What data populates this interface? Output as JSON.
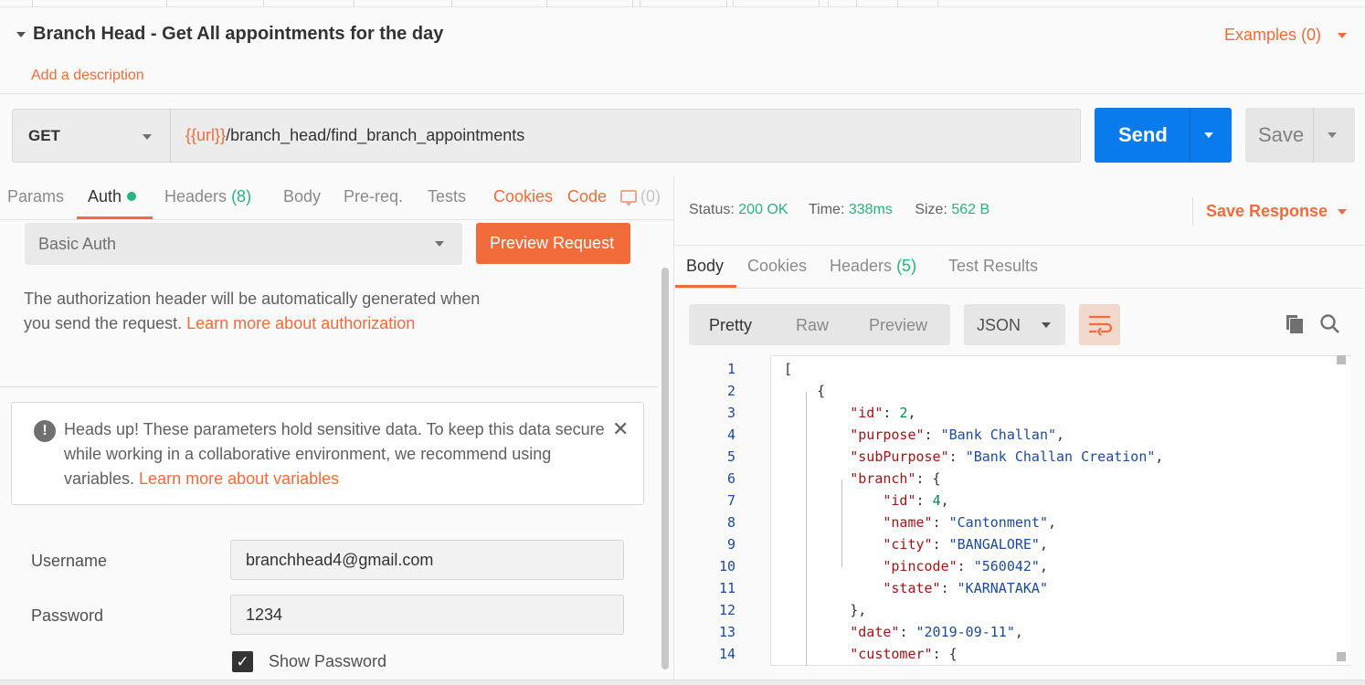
{
  "request": {
    "title": "Branch Head - Get All appointments for the day",
    "examples_label": "Examples (0)",
    "add_description": "Add a description",
    "method": "GET",
    "url_variable": "{{url}}",
    "url_path": "/branch_head/find_branch_appointments",
    "send_label": "Send",
    "save_label": "Save"
  },
  "request_tabs": {
    "params": "Params",
    "auth": "Auth",
    "headers": "Headers",
    "headers_count": "(8)",
    "body": "Body",
    "prereq": "Pre-req.",
    "tests": "Tests",
    "cookies": "Cookies",
    "code": "Code",
    "comments_count": "(0)"
  },
  "auth": {
    "type": "Basic Auth",
    "preview_label": "Preview Request",
    "description_text": "The authorization header will be automatically generated when you send the request. ",
    "description_link": "Learn more about authorization",
    "warning_text": "Heads up! These parameters hold sensitive data. To keep this data secure while working in a collaborative environment, we recommend using variables. ",
    "warning_link": "Learn more about variables",
    "username_label": "Username",
    "username_value": "branchhead4@gmail.com",
    "password_label": "Password",
    "password_value": "1234",
    "show_password_label": "Show Password"
  },
  "response": {
    "status_label": "Status:",
    "status_value": "200 OK",
    "time_label": "Time:",
    "time_value": "338ms",
    "size_label": "Size:",
    "size_value": "562 B",
    "save_response": "Save Response",
    "tabs": {
      "body": "Body",
      "cookies": "Cookies",
      "headers": "Headers",
      "headers_count": "(5)",
      "test_results": "Test Results"
    },
    "views": {
      "pretty": "Pretty",
      "raw": "Raw",
      "preview": "Preview"
    },
    "language": "JSON"
  },
  "code_lines": [
    {
      "n": "1",
      "t": "["
    },
    {
      "n": "2",
      "t": "    {"
    },
    {
      "n": "3",
      "t": "        \"id\": 2,"
    },
    {
      "n": "4",
      "t": "        \"purpose\": \"Bank Challan\","
    },
    {
      "n": "5",
      "t": "        \"subPurpose\": \"Bank Challan Creation\","
    },
    {
      "n": "6",
      "t": "        \"branch\": {"
    },
    {
      "n": "7",
      "t": "            \"id\": 4,"
    },
    {
      "n": "8",
      "t": "            \"name\": \"Cantonment\","
    },
    {
      "n": "9",
      "t": "            \"city\": \"BANGALORE\","
    },
    {
      "n": "10",
      "t": "            \"pincode\": \"560042\","
    },
    {
      "n": "11",
      "t": "            \"state\": \"KARNATAKA\""
    },
    {
      "n": "12",
      "t": "        },"
    },
    {
      "n": "13",
      "t": "        \"date\": \"2019-09-11\","
    },
    {
      "n": "14",
      "t": "        \"customer\": {"
    }
  ],
  "colors": {
    "accent": "#f26b3a",
    "send_blue": "#097bed",
    "success_green": "#26b47f"
  }
}
